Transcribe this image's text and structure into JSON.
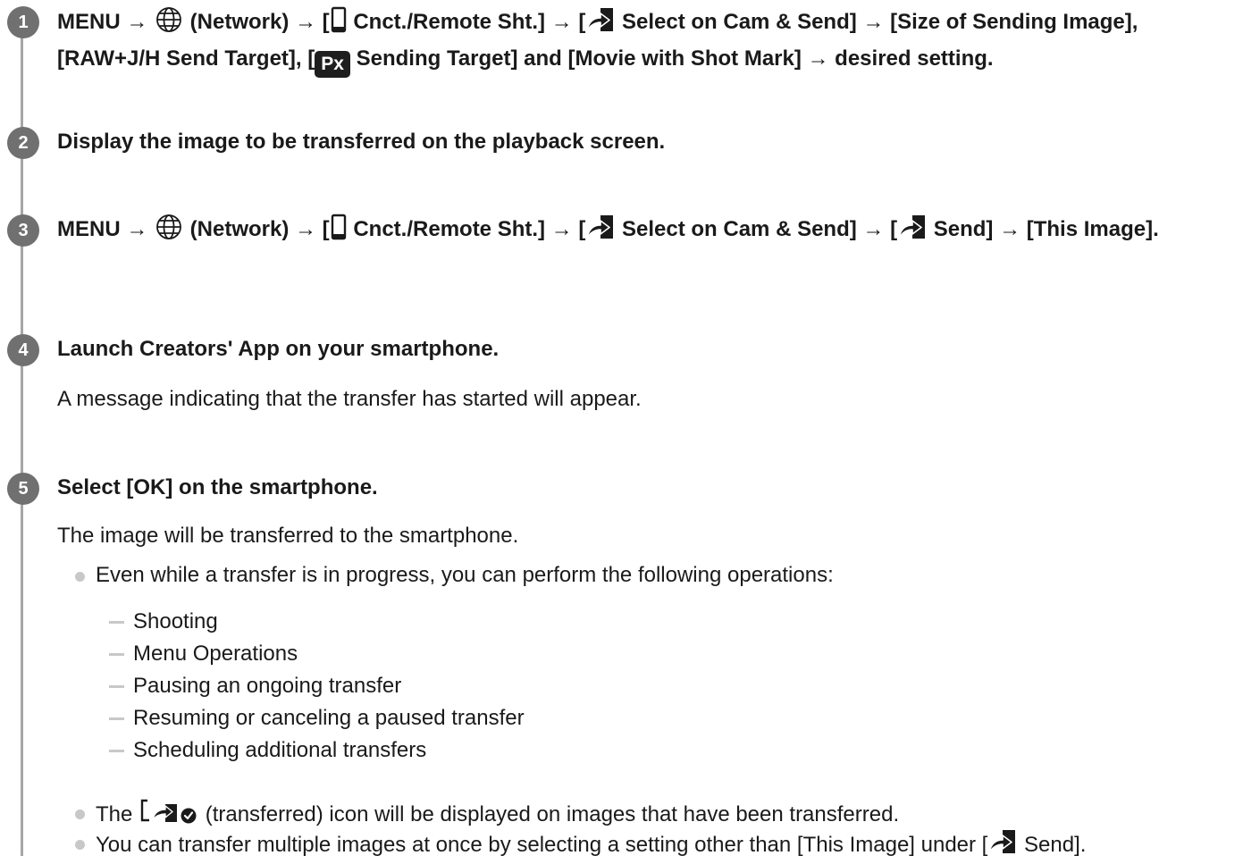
{
  "steps": [
    {
      "number": "1",
      "heading": {
        "t1": "MENU → ",
        "t2": " (Network) → [",
        "t3": " Cnct./Remote Sht.] → [",
        "t4": " Select on Cam & Send] → [Size of Sending Image], [RAW+J/H Send Target], [",
        "t5": "Px",
        "t6": " Sending Target] and [Movie with Shot Mark] → desired setting."
      }
    },
    {
      "number": "2",
      "heading": "Display the image to be transferred on the playback screen."
    },
    {
      "number": "3",
      "heading": {
        "t1": "MENU → ",
        "t2": " (Network) → [",
        "t3": " Cnct./Remote Sht.] → [",
        "t4": " Select on Cam & Send] → [",
        "t5": " Send] → [This Image]."
      }
    },
    {
      "number": "4",
      "heading": "Launch Creators' App on your smartphone.",
      "description": "A message indicating that the transfer has started will appear."
    },
    {
      "number": "5",
      "heading": "Select [OK] on the smartphone.",
      "description": "The image will be transferred to the smartphone.",
      "notes": [
        "Even while a transfer is in progress, you can perform the following operations:",
        {
          "before": "The ",
          "after": " (transferred) icon will be displayed on images that have been transferred."
        },
        {
          "before": "You can transfer multiple images at once by selecting a setting other than [This Image] under [",
          "after": " Send]."
        }
      ],
      "operations": [
        "Shooting",
        "Menu Operations",
        "Pausing an ongoing transfer",
        "Resuming or canceling a paused transfer",
        "Scheduling additional transfers"
      ]
    }
  ],
  "icons": {
    "network": "globe-icon",
    "remote_sht": "smartphone-icon",
    "send": "send-arrow-icon",
    "transferred": "transferred-check-icon"
  },
  "colors": {
    "text": "#1a1a1a",
    "step_badge": "#707070",
    "timeline": "#a6a6a6",
    "bullet": "#c8c8c8"
  }
}
